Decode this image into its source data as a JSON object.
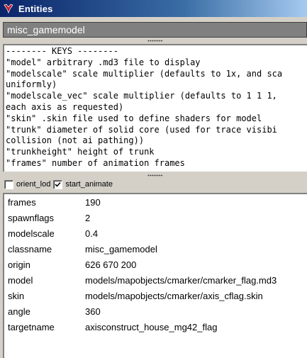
{
  "window": {
    "title": "Entities"
  },
  "classname_bar": {
    "text": "misc_gamemodel"
  },
  "keys": {
    "lines": [
      "-------- KEYS --------",
      "\"model\" arbitrary .md3 file to display",
      "\"modelscale\" scale multiplier (defaults to 1x, and sca",
      "uniformly)",
      "\"modelscale_vec\" scale multiplier (defaults to 1 1 1,",
      "each axis as requested)",
      "\"skin\" .skin file used to define shaders for model",
      "\"trunk\" diameter of solid core (used for trace visibi",
      "collision (not ai pathing))",
      "\"trunkheight\" height of trunk",
      "\"frames\" number of animation frames"
    ]
  },
  "spawnflags": [
    {
      "label": "orient_lod",
      "checked": false
    },
    {
      "label": "start_animate",
      "checked": true
    }
  ],
  "properties": [
    {
      "key": "frames",
      "value": "190"
    },
    {
      "key": "spawnflags",
      "value": "2"
    },
    {
      "key": "modelscale",
      "value": "0.4"
    },
    {
      "key": "classname",
      "value": "misc_gamemodel"
    },
    {
      "key": "origin",
      "value": "626 670 200"
    },
    {
      "key": "model",
      "value": "models/mapobjects/cmarker/cmarker_flag.md3"
    },
    {
      "key": "skin",
      "value": "models/mapobjects/cmarker/axis_cflag.skin"
    },
    {
      "key": "angle",
      "value": "360"
    },
    {
      "key": "targetname",
      "value": "axisconstruct_house_mg42_flag"
    }
  ],
  "icons": {
    "app": "radiant-app-icon",
    "check": "checkmark-icon",
    "grip": "splitter-grip-icon"
  },
  "colors": {
    "titlebar_start": "#0a246a",
    "titlebar_end": "#a6caf0",
    "classname_bg": "#808080",
    "window_bg": "#d4d0c8"
  }
}
